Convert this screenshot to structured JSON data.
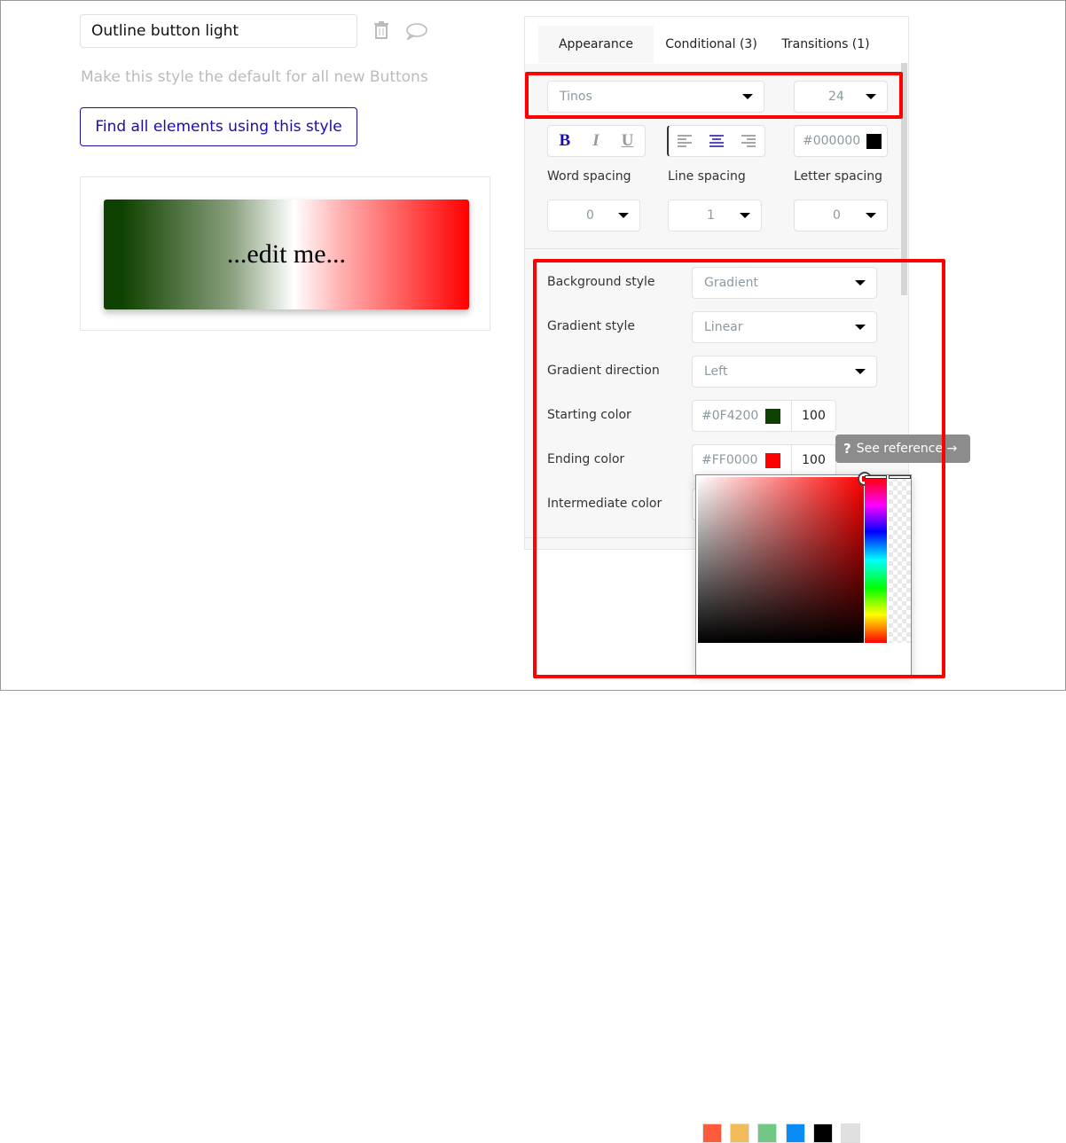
{
  "style_name": "Outline button light",
  "default_text": "Make this style the default for all new Buttons",
  "find_button": "Find all elements using this style",
  "preview_text": "...edit me...",
  "tabs": [
    {
      "label": "Appearance",
      "active": true
    },
    {
      "label": "Conditional (3)"
    },
    {
      "label": "Transitions (1)"
    }
  ],
  "font": {
    "family": "Tinos",
    "size": "24",
    "color": "#000000",
    "bold": "B",
    "italic": "I",
    "underline": "U",
    "align": "center"
  },
  "spacing": {
    "word_label": "Word spacing",
    "word": "0",
    "line_label": "Line spacing",
    "line": "1",
    "letter_label": "Letter spacing",
    "letter": "0"
  },
  "background": {
    "style_label": "Background style",
    "style": "Gradient",
    "gradient_style_label": "Gradient style",
    "gradient_style": "Linear",
    "direction_label": "Gradient direction",
    "direction": "Left",
    "start_label": "Starting color",
    "start_color": "#0F4200",
    "start_opacity": "100",
    "end_label": "Ending color",
    "end_color": "#FF0000",
    "end_opacity": "100",
    "intermediate_label": "Intermediate color"
  },
  "tooltip": {
    "icon": "?",
    "text": "See reference →"
  },
  "picker": {
    "hue": "#FF0000",
    "swatches": [
      "#FF5A3C",
      "#F2BC5A",
      "#71C784",
      "#0A8BF5",
      "#000000",
      "#E0E0E0"
    ]
  },
  "colors": {
    "accent": "#1a0dab",
    "highlight": "#ff0000"
  }
}
